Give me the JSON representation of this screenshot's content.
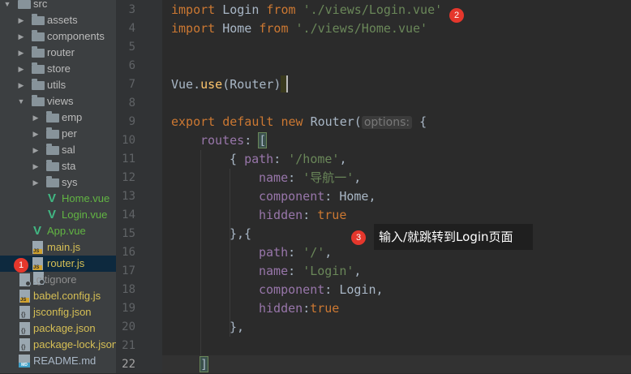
{
  "tree": {
    "items": [
      {
        "label": "src",
        "icon": "folder-icon",
        "expanded": true
      },
      {
        "label": "assets",
        "icon": "folder-icon"
      },
      {
        "label": "components",
        "icon": "folder-icon"
      },
      {
        "label": "router",
        "icon": "folder-icon"
      },
      {
        "label": "store",
        "icon": "folder-icon"
      },
      {
        "label": "utils",
        "icon": "folder-icon"
      },
      {
        "label": "views",
        "icon": "folder-icon",
        "expanded": true
      },
      {
        "label": "emp",
        "icon": "folder-icon"
      },
      {
        "label": "per",
        "icon": "folder-icon"
      },
      {
        "label": "sal",
        "icon": "folder-icon"
      },
      {
        "label": "sta",
        "icon": "folder-icon"
      },
      {
        "label": "sys",
        "icon": "folder-icon"
      },
      {
        "label": "Home.vue",
        "icon": "vue-file-icon"
      },
      {
        "label": "Login.vue",
        "icon": "vue-file-icon"
      },
      {
        "label": "App.vue",
        "icon": "vue-file-icon"
      },
      {
        "label": "main.js",
        "icon": "js-file-icon"
      },
      {
        "label": "router.js",
        "icon": "js-file-icon",
        "selected": true
      },
      {
        "label": ".gitignore",
        "icon": "gitignore-file-icon"
      },
      {
        "label": "babel.config.js",
        "icon": "js-file-icon"
      },
      {
        "label": "jsconfig.json",
        "icon": "json-file-icon"
      },
      {
        "label": "package.json",
        "icon": "json-file-icon"
      },
      {
        "label": "package-lock.json",
        "icon": "json-file-icon"
      },
      {
        "label": "README.md",
        "icon": "markdown-file-icon"
      }
    ]
  },
  "badges": {
    "b1": "1",
    "b2": "2",
    "b3": "3"
  },
  "tooltip": {
    "text": "输入/就跳转到Login页面"
  },
  "editor": {
    "line_numbers": [
      "3",
      "4",
      "5",
      "6",
      "7",
      "8",
      "9",
      "10",
      "11",
      "12",
      "13",
      "14",
      "15",
      "16",
      "17",
      "18",
      "19",
      "20",
      "21",
      "22"
    ],
    "current_line": "22",
    "tokens": {
      "l3": [
        "import",
        " Login ",
        "from",
        " ",
        "'./views/Login.vue'"
      ],
      "l4": [
        "import",
        " Home ",
        "from",
        " ",
        "'./views/Home.vue'"
      ],
      "l7": [
        "Vue.",
        "use",
        "(Router)"
      ],
      "l9": [
        "export",
        " ",
        "default",
        " ",
        "new",
        " Router(",
        "options:",
        " {"
      ],
      "l10": [
        "routes",
        ": ",
        "["
      ],
      "l11": [
        "{ ",
        "path",
        ": ",
        "'/home'",
        ","
      ],
      "l12": [
        "name",
        ": ",
        "'导航一'",
        ","
      ],
      "l13": [
        "component",
        ": Home,"
      ],
      "l14": [
        "hidden",
        ": ",
        "true"
      ],
      "l15": [
        "},{"
      ],
      "l16": [
        "path",
        ": ",
        "'/'",
        ","
      ],
      "l17": [
        "name",
        ": ",
        "'Login'",
        ","
      ],
      "l18": [
        "component",
        ": Login,"
      ],
      "l19": [
        "hidden",
        ":",
        "true"
      ],
      "l20": [
        "},"
      ],
      "l22": [
        "]"
      ]
    }
  },
  "colors": {
    "keyword": "#cc7832",
    "string": "#6a8759",
    "property": "#9876aa",
    "function": "#ffc66d",
    "badge": "#e5372c"
  }
}
